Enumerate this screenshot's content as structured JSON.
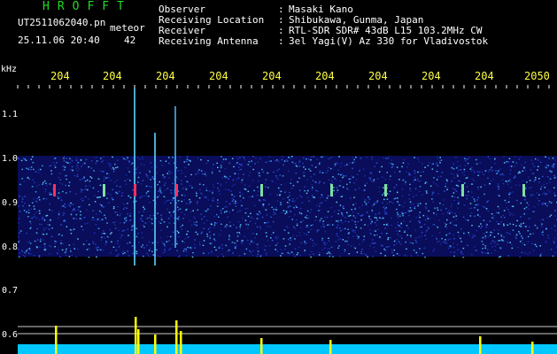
{
  "header": {
    "app_title": "HROFFT",
    "file_name": "UT2511062040.pn",
    "meteor_label": "meteor",
    "datetime": "25.11.06 20:40",
    "count": "42"
  },
  "info": [
    {
      "key": "Observer",
      "value": "Masaki Kano"
    },
    {
      "key": "Receiving Location",
      "value": "Shibukawa, Gunma, Japan"
    },
    {
      "key": "Receiver",
      "value": "RTL-SDR SDR# 43dB L15 103.2MHz CW"
    },
    {
      "key": "Receiving Antenna",
      "value": "3el Yagi(V) Az 330 for Vladivostok"
    }
  ],
  "axis": {
    "unit_label": "kHz",
    "x_ticks": [
      "204",
      "204",
      "204",
      "204",
      "204",
      "204",
      "204",
      "204",
      "204",
      "2050"
    ],
    "y_ticks": [
      "1.1",
      "1.0",
      "0.9",
      "0.8",
      "0.7",
      "0.6"
    ]
  },
  "colors": {
    "background": "#000000",
    "title": "#22dd22",
    "tick_labels": "#ffff44",
    "noise_low": "#1a2aa8",
    "noise_high": "#3fa8e8",
    "meteor_echo": "#ff3060",
    "baseline": "#00c8ff",
    "spike": "#ffff00"
  }
}
